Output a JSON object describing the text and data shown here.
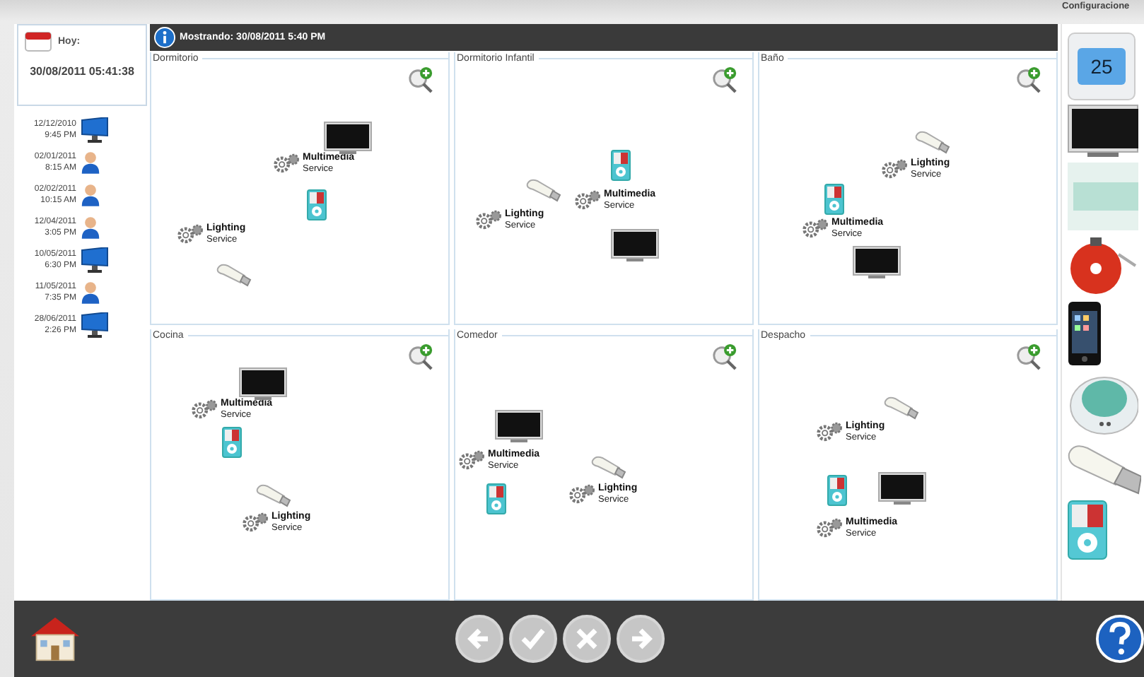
{
  "today": {
    "label": "Hoy:",
    "datetime": "30/08/2011 05:41:38"
  },
  "history": [
    {
      "date": "12/12/2010",
      "time": "9:45 PM",
      "kind": "monitor"
    },
    {
      "date": "02/01/2011",
      "time": "8:15 AM",
      "kind": "user"
    },
    {
      "date": "02/02/2011",
      "time": "10:15 AM",
      "kind": "user"
    },
    {
      "date": "12/04/2011",
      "time": "3:05 PM",
      "kind": "user"
    },
    {
      "date": "10/05/2011",
      "time": "6:30 PM",
      "kind": "monitor"
    },
    {
      "date": "11/05/2011",
      "time": "7:35 PM",
      "kind": "user"
    },
    {
      "date": "28/06/2011",
      "time": "2:26 PM",
      "kind": "monitor"
    }
  ],
  "header": {
    "text": "Mostrando: 30/08/2011 5:40 PM"
  },
  "rooms": [
    {
      "name": "Dormitorio",
      "nodes": [
        {
          "kind": "service",
          "name": "Multimedia",
          "sub": "Service"
        },
        {
          "kind": "tv"
        },
        {
          "kind": "ipod"
        },
        {
          "kind": "service",
          "name": "Lighting",
          "sub": "Service"
        },
        {
          "kind": "bulb"
        }
      ]
    },
    {
      "name": "Dormitorio Infantil",
      "nodes": [
        {
          "kind": "service",
          "name": "Multimedia",
          "sub": "Service"
        },
        {
          "kind": "tv"
        },
        {
          "kind": "ipod"
        },
        {
          "kind": "service",
          "name": "Lighting",
          "sub": "Service"
        },
        {
          "kind": "bulb"
        }
      ]
    },
    {
      "name": "Baño",
      "nodes": [
        {
          "kind": "service",
          "name": "Multimedia",
          "sub": "Service"
        },
        {
          "kind": "tv"
        },
        {
          "kind": "ipod"
        },
        {
          "kind": "service",
          "name": "Lighting",
          "sub": "Service"
        },
        {
          "kind": "bulb"
        }
      ]
    },
    {
      "name": "Cocina",
      "nodes": [
        {
          "kind": "service",
          "name": "Multimedia",
          "sub": "Service"
        },
        {
          "kind": "tv"
        },
        {
          "kind": "ipod"
        },
        {
          "kind": "service",
          "name": "Lighting",
          "sub": "Service"
        },
        {
          "kind": "bulb"
        }
      ]
    },
    {
      "name": "Comedor",
      "nodes": [
        {
          "kind": "service",
          "name": "Multimedia",
          "sub": "Service"
        },
        {
          "kind": "tv"
        },
        {
          "kind": "ipod"
        },
        {
          "kind": "service",
          "name": "Lighting",
          "sub": "Service"
        },
        {
          "kind": "bulb"
        }
      ]
    },
    {
      "name": "Despacho",
      "nodes": [
        {
          "kind": "bulb"
        },
        {
          "kind": "service",
          "name": "Lighting",
          "sub": "Service"
        },
        {
          "kind": "tv"
        },
        {
          "kind": "ipod"
        },
        {
          "kind": "service",
          "name": "Multimedia",
          "sub": "Service"
        }
      ]
    }
  ],
  "palette": {
    "title": "Configuracione",
    "items": [
      {
        "kind": "thermostat",
        "display": "25"
      },
      {
        "kind": "tv"
      },
      {
        "kind": "panel"
      },
      {
        "kind": "alarm"
      },
      {
        "kind": "phone"
      },
      {
        "kind": "sensor"
      },
      {
        "kind": "bulb"
      },
      {
        "kind": "ipod"
      }
    ]
  },
  "toolbar": [
    {
      "kind": "back",
      "disabled": true
    },
    {
      "kind": "confirm",
      "disabled": true
    },
    {
      "kind": "cancel",
      "disabled": true
    },
    {
      "kind": "forward",
      "disabled": true
    }
  ]
}
